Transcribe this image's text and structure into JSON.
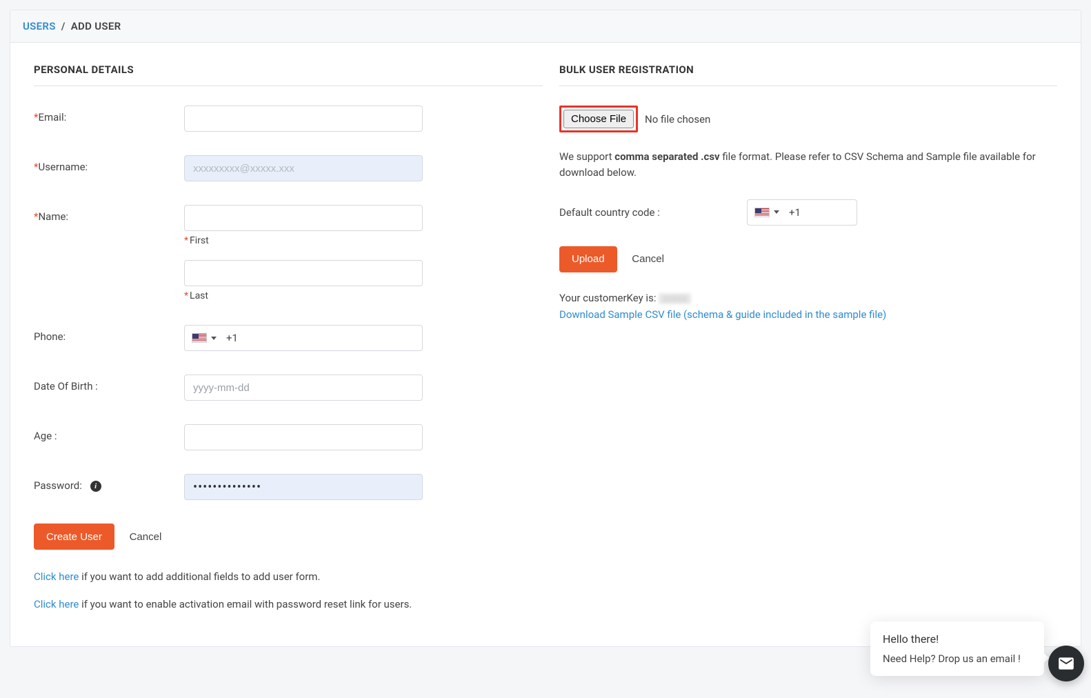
{
  "breadcrumb": {
    "link": "USERS",
    "current": "ADD USER"
  },
  "personal": {
    "title": "PERSONAL DETAILS",
    "labels": {
      "email": "Email:",
      "username": "Username:",
      "name": "Name:",
      "first": "First",
      "last": "Last",
      "phone": "Phone:",
      "dob": "Date Of Birth :",
      "age": "Age :",
      "password": "Password:"
    },
    "values": {
      "username": "xxxxxxxxx@xxxxx.xxx",
      "phone_code": "+1",
      "dob_placeholder": "yyyy-mm-dd",
      "password_mask": "••••••••••••••"
    },
    "buttons": {
      "create": "Create User",
      "cancel": "Cancel"
    },
    "helpers": {
      "click_here": "Click here",
      "add_fields": " if you want to add additional fields to add user form.",
      "activation": " if you want to enable activation email with password reset link for users."
    }
  },
  "bulk": {
    "title": "BULK USER REGISTRATION",
    "file": {
      "button": "Choose File",
      "status": "No file chosen"
    },
    "support_pre": "We support ",
    "support_bold": "comma separated .csv",
    "support_post": " file format. Please refer to CSV Schema and Sample file available for download below.",
    "cc_label": "Default country code :",
    "cc_value": "+1",
    "buttons": {
      "upload": "Upload",
      "cancel": "Cancel"
    },
    "customer_key_label": "Your customerKey is: ",
    "customer_key_value": "xxxxx",
    "download_link": "Download Sample CSV file (schema & guide included in the sample file)"
  },
  "chat": {
    "line1": "Hello there!",
    "line2": "Need Help? Drop us an email !"
  }
}
